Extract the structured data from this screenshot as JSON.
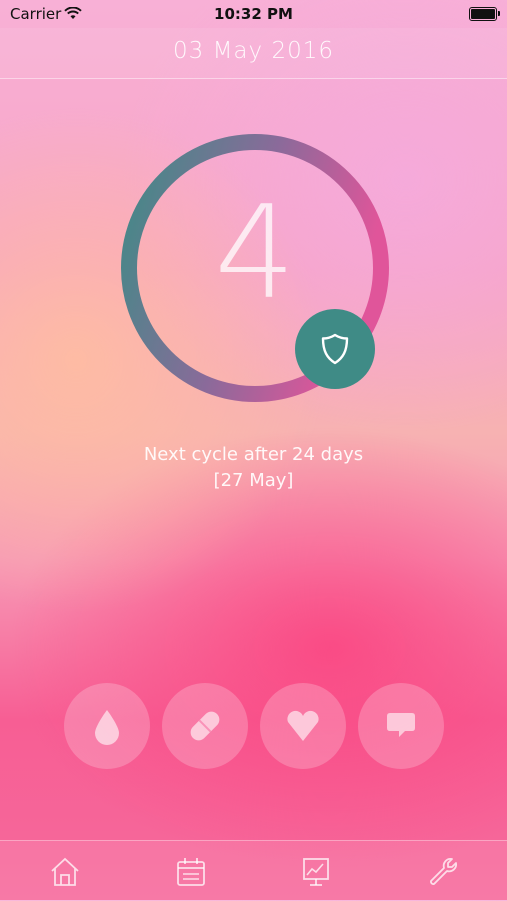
{
  "status_bar": {
    "carrier": "Carrier",
    "time": "10:32 PM"
  },
  "header": {
    "date": "03 May 2016"
  },
  "cycle": {
    "day_number": "4",
    "next_cycle_text": "Next cycle after 24 days",
    "next_cycle_date": "[27 May]"
  },
  "actions": [
    {
      "icon": "drop-icon"
    },
    {
      "icon": "pill-icon"
    },
    {
      "icon": "heart-icon"
    },
    {
      "icon": "chat-bubble-icon"
    }
  ],
  "tabs": [
    {
      "icon": "home-icon"
    },
    {
      "icon": "calendar-icon"
    },
    {
      "icon": "chart-icon"
    },
    {
      "icon": "wrench-icon"
    }
  ],
  "colors": {
    "ring_start": "#3f8b86",
    "ring_end": "#e0559a",
    "shield_button": "#3f8b86"
  }
}
